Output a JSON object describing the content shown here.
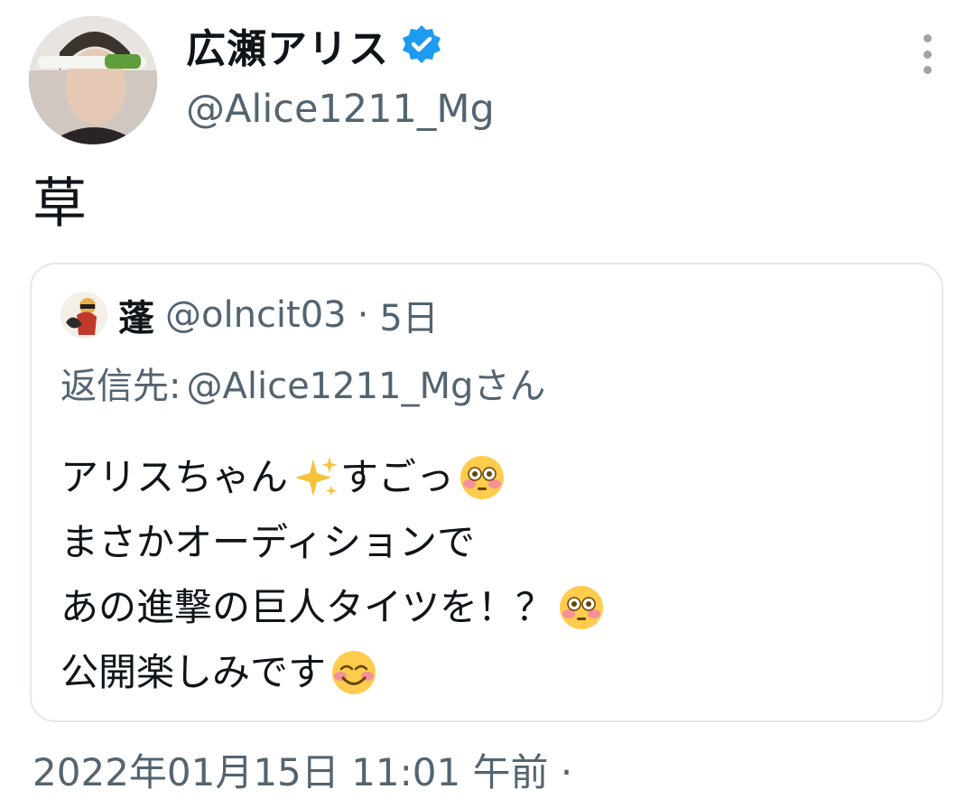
{
  "author": {
    "display_name": "広瀬アリス",
    "handle": "@Alice1211_Mg",
    "verified": true,
    "avatar": "profile-photo"
  },
  "tweet": {
    "text": "草",
    "timestamp": "2022年01月15日 11:01 午前 ·"
  },
  "quoted_tweet": {
    "author_name": "蓬",
    "author_handle": "@olncit03",
    "separator": "·",
    "time_ago": "5日",
    "reply_label": "返信先:",
    "reply_to": "@Alice1211_Mgさん",
    "lines": [
      {
        "text": "アリスちゃん",
        "emoji": "sparkles-emoji",
        "text2": "すごっ",
        "emoji2": "flushed-face-emoji"
      },
      {
        "text": "まさかオーディションで"
      },
      {
        "text": "あの進撃の巨人タイツを！？",
        "emoji": "flushed-face-emoji"
      },
      {
        "text": "公開楽しみです",
        "emoji": "smiling-face-emoji"
      }
    ]
  },
  "colors": {
    "text": "#0f1419",
    "secondary": "#536471",
    "verified": "#1d9bf0",
    "border": "#e3e7ea"
  }
}
